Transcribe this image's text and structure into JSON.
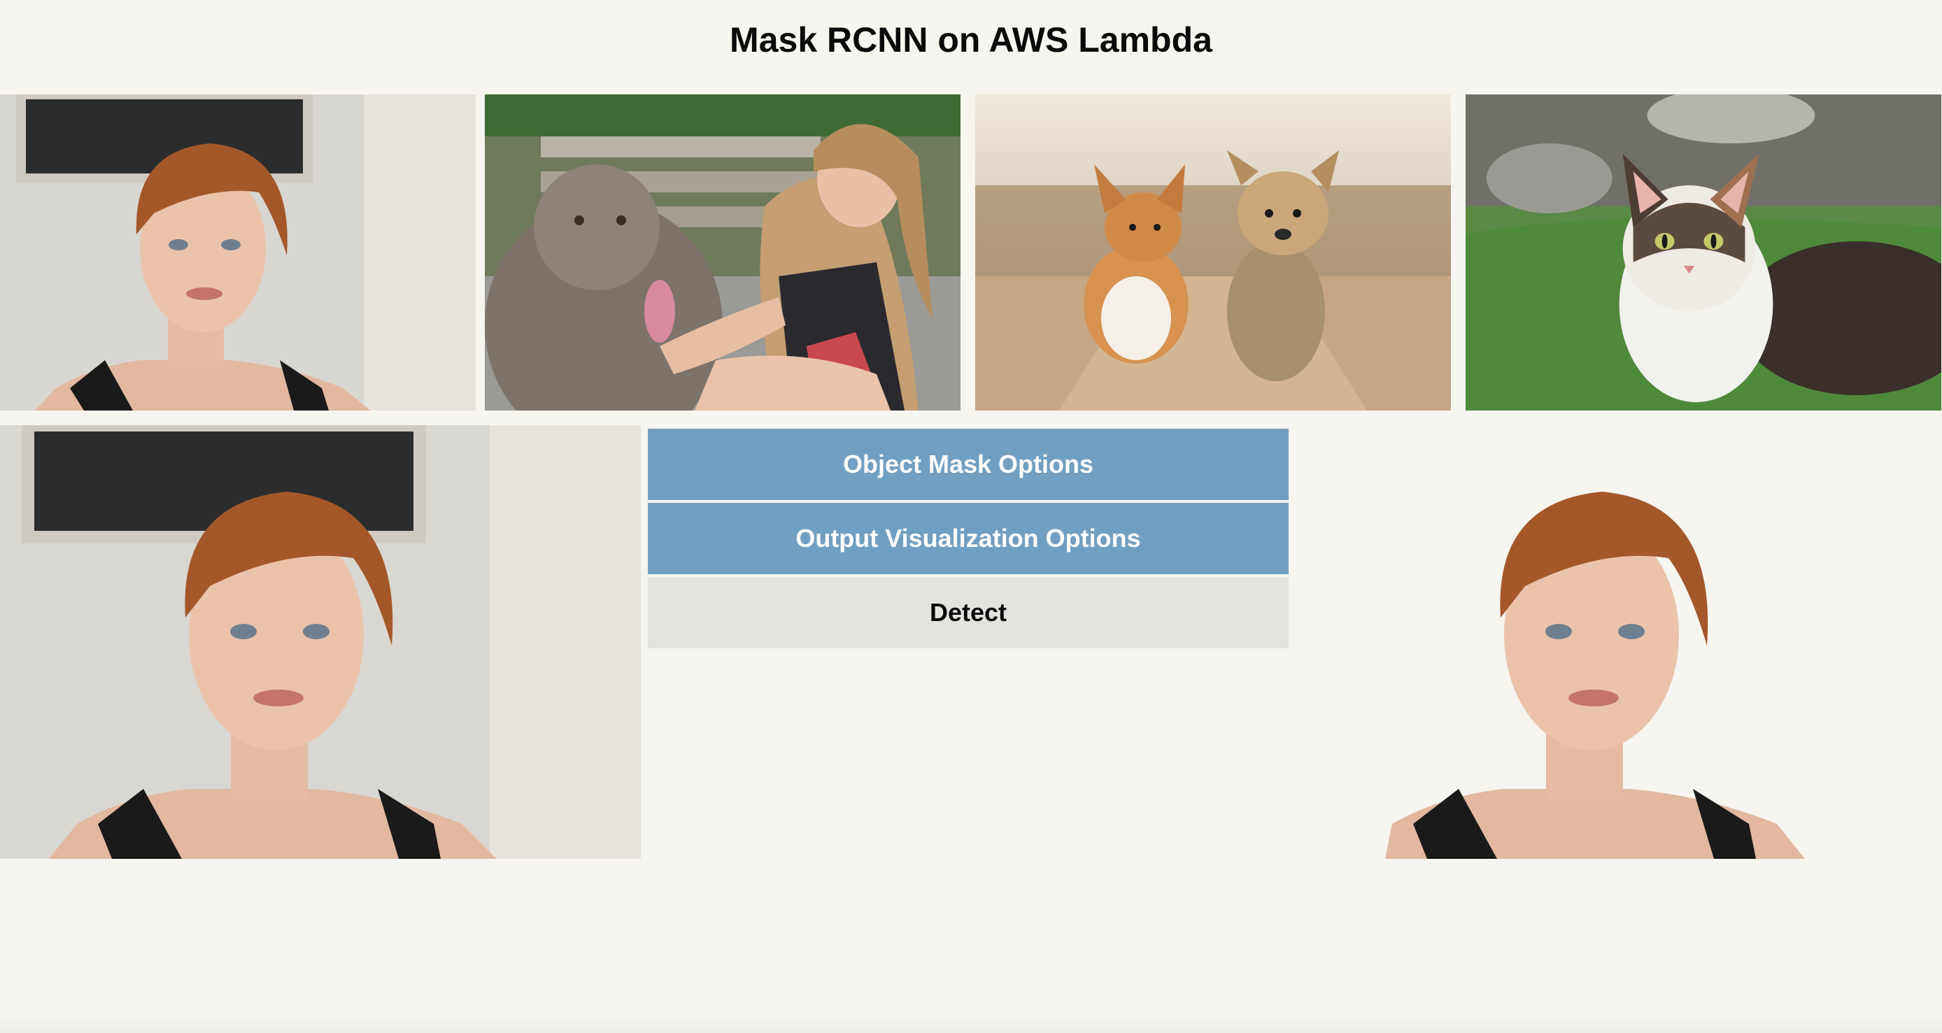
{
  "page": {
    "title": "Mask RCNN on AWS Lambda"
  },
  "gallery": {
    "items": [
      {
        "name": "woman-with-red-hair",
        "icon": "woman-photo"
      },
      {
        "name": "woman-with-dog",
        "icon": "woman-dog-photo"
      },
      {
        "name": "two-dogs-running",
        "icon": "dogs-photo"
      },
      {
        "name": "cat-in-grass",
        "icon": "cat-photo"
      }
    ]
  },
  "controls": {
    "mask_options_label": "Object Mask Options",
    "visualization_options_label": "Output Visualization Options",
    "detect_label": "Detect"
  },
  "colors": {
    "background": "#f6f5f0",
    "accent_button": "#719fc1",
    "detect_button": "#e4e3df"
  }
}
